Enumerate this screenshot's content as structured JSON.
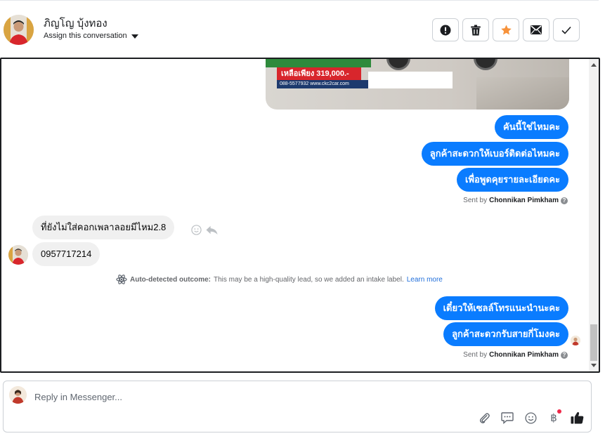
{
  "header": {
    "contact_name": "ภิญโญ บุ้งทอง",
    "assign_label": "Assign this conversation",
    "actions": [
      {
        "name": "mark-spam-button",
        "icon": "exclamation-icon"
      },
      {
        "name": "delete-button",
        "icon": "trash-icon"
      },
      {
        "name": "follow-up-button",
        "icon": "star-icon"
      },
      {
        "name": "mark-unread-button",
        "icon": "envelope-icon"
      },
      {
        "name": "mark-done-button",
        "icon": "checkmark-icon"
      }
    ]
  },
  "ad": {
    "price_text": "เหลือเพียง 319,000.-",
    "url_text": "088-5577932 www.ckc2car.com"
  },
  "messages": {
    "out1": "คันนี้ใช่ไหมคะ",
    "out2": "ลูกค้าสะดวกให้เบอร์ติดต่อไหมคะ",
    "out3": "เพื่อพูดคุยรายละเอียดคะ",
    "sent_by_1_prefix": "Sent by",
    "sent_by_1_name": "Chonnikan Pimkham",
    "in1": "ที่ยังไม่ใส่คอกเพลาลอยมีไหม2.8",
    "in2": "0957717214",
    "outcome_title": "Auto-detected outcome:",
    "outcome_text": "This may be a high-quality lead, so we added an intake label.",
    "outcome_link": "Learn more",
    "out4": "เดี๋ยวให้เซลล์โทรแนะนำนะคะ",
    "out5": "ลูกค้าสะดวกรับสายกี่โมงคะ",
    "sent_by_2_prefix": "Sent by",
    "sent_by_2_name": "Chonnikan Pimkham"
  },
  "reply": {
    "placeholder": "Reply in Messenger...",
    "baht_symbol": "฿"
  },
  "colors": {
    "outgoing_bubble": "#0a7cff",
    "incoming_bubble": "#f0f0f0",
    "link": "#216fdb",
    "star": "#f7923a",
    "notification_dot": "#f02849"
  }
}
